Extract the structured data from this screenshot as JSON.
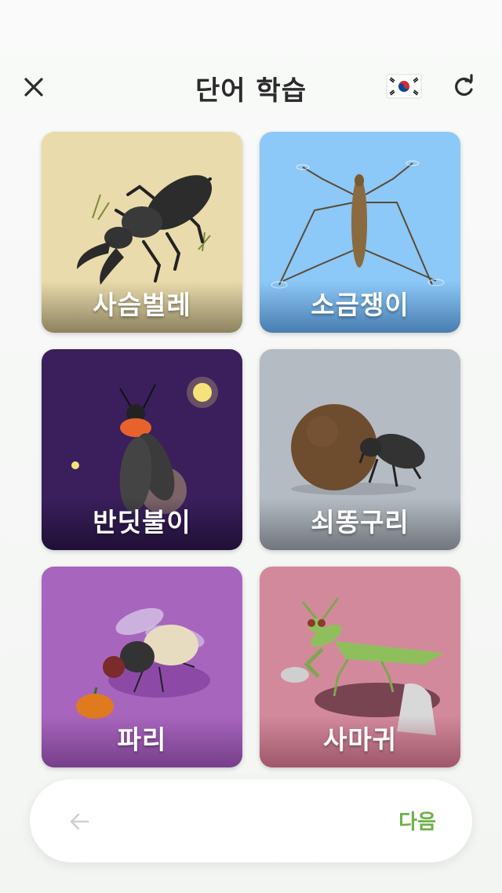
{
  "header": {
    "title": "단어 학습"
  },
  "icons": {
    "close": "close-icon",
    "flag": "korea-flag-icon",
    "refresh": "refresh-icon",
    "back": "arrow-left-icon"
  },
  "cards": [
    {
      "label": "사슴벌레",
      "bg": "#e9dbab"
    },
    {
      "label": "소금쟁이",
      "bg": "#8cc8f8"
    },
    {
      "label": "반딧불이",
      "bg": "#3a1f5c"
    },
    {
      "label": "쇠똥구리",
      "bg": "#b4bbc2"
    },
    {
      "label": "파리",
      "bg": "#a865bd"
    },
    {
      "label": "사마귀",
      "bg": "#d3899c"
    }
  ],
  "footer": {
    "next_label": "다음"
  },
  "colors": {
    "accent": "#6cb244"
  }
}
